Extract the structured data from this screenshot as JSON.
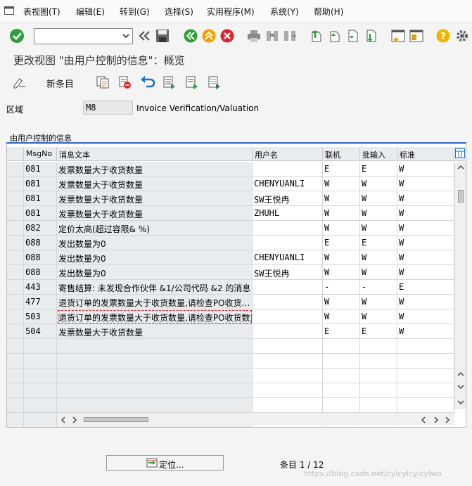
{
  "menu": [
    "表视图(T)",
    "编辑(E)",
    "转到(G)",
    "选择(S)",
    "实用程序(M)",
    "系统(Y)",
    "帮助(H)"
  ],
  "title": "更改视图 \"由用户控制的信息\"：概览",
  "toolbar": {
    "new_entries": "新条目"
  },
  "area": {
    "label": "区域",
    "value": "M8",
    "description": "Invoice Verification/Valuation"
  },
  "table": {
    "title": "由用户控制的信息",
    "columns": [
      "MsgNo",
      "消息文本",
      "用户名",
      "联机",
      "批输入",
      "标准"
    ],
    "rows": [
      {
        "msgno": "081",
        "text": "发票数量大于收货数量",
        "user": "",
        "online": "E",
        "batch": "E",
        "standard": "W"
      },
      {
        "msgno": "081",
        "text": "发票数量大于收货数量",
        "user": "CHENYUANLI",
        "online": "W",
        "batch": "W",
        "standard": "W"
      },
      {
        "msgno": "081",
        "text": "发票数量大于收货数量",
        "user": "SW王悦冉",
        "online": "W",
        "batch": "W",
        "standard": "W"
      },
      {
        "msgno": "081",
        "text": "发票数量大于收货数量",
        "user": "ZHUHL",
        "online": "W",
        "batch": "W",
        "standard": "W"
      },
      {
        "msgno": "082",
        "text": "定价太高(超过容限& %)",
        "user": "",
        "online": "W",
        "batch": "W",
        "standard": "W"
      },
      {
        "msgno": "088",
        "text": "发出数量为0",
        "user": "",
        "online": "E",
        "batch": "E",
        "standard": "W"
      },
      {
        "msgno": "088",
        "text": "发出数量为0",
        "user": "CHENYUANLI",
        "online": "W",
        "batch": "W",
        "standard": "W"
      },
      {
        "msgno": "088",
        "text": "发出数量为0",
        "user": "SW王悦冉",
        "online": "W",
        "batch": "W",
        "standard": "W"
      },
      {
        "msgno": "443",
        "text": "寄售结算: 未发现合作伙伴 &1/公司代码 &2 的消息",
        "user": "",
        "online": "-",
        "batch": "-",
        "standard": "E"
      },
      {
        "msgno": "477",
        "text": "退货订单的发票数量大于收货数量,请检查PO收货…",
        "user": "",
        "online": "W",
        "batch": "W",
        "standard": "W"
      },
      {
        "msgno": "503",
        "text": "退货订单的发票数量大于收货数量,请检查PO收货数量",
        "user": "",
        "online": "W",
        "batch": "W",
        "standard": "W"
      },
      {
        "msgno": "504",
        "text": "发票数量大于收货数量",
        "user": "",
        "online": "E",
        "batch": "E",
        "standard": "W"
      }
    ],
    "empty_rows": 6
  },
  "position_button": "定位...",
  "entries": "条目 1 / 12",
  "watermark": "https://blog.csdn.net/cylcylcylcylwo"
}
